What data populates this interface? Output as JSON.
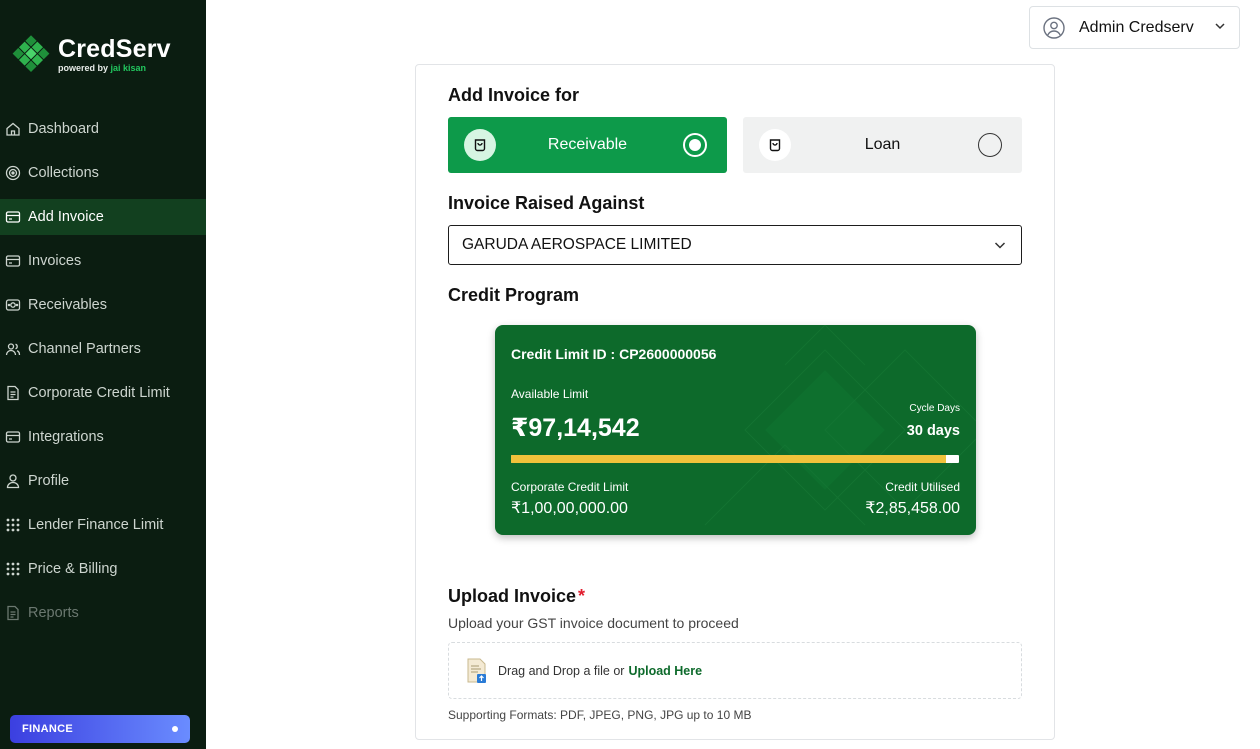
{
  "brand": {
    "name": "CredServ",
    "powered_by": "powered by",
    "powered_name": "jai kisan"
  },
  "sidebar": {
    "items": [
      {
        "label": "Dashboard",
        "icon": "home-icon"
      },
      {
        "label": "Collections",
        "icon": "target-icon"
      },
      {
        "label": "Add Invoice",
        "icon": "invoice-icon",
        "active": true
      },
      {
        "label": "Invoices",
        "icon": "invoice-icon"
      },
      {
        "label": "Receivables",
        "icon": "receivables-icon"
      },
      {
        "label": "Channel Partners",
        "icon": "users-icon"
      },
      {
        "label": "Corporate Credit Limit",
        "icon": "document-icon"
      },
      {
        "label": "Integrations",
        "icon": "integrations-icon"
      },
      {
        "label": "Profile",
        "icon": "user-icon"
      },
      {
        "label": "Lender Finance Limit",
        "icon": "dots-grid-icon"
      },
      {
        "label": "Price & Billing",
        "icon": "dots-grid-icon"
      },
      {
        "label": "Reports",
        "icon": "document-icon",
        "disabled": true
      }
    ],
    "badge": "FINANCE"
  },
  "header": {
    "user_name": "Admin Credserv"
  },
  "form": {
    "add_invoice_for": "Add Invoice for",
    "options": {
      "receivable": "Receivable",
      "loan": "Loan",
      "selected": "Receivable"
    },
    "raised_against_label": "Invoice Raised Against",
    "raised_against_value": "GARUDA AEROSPACE LIMITED",
    "credit_program_label": "Credit Program"
  },
  "credit_card": {
    "id_text": "Credit Limit ID : CP2600000056",
    "available_label": "Available Limit",
    "available_value": "₹97,14,542",
    "cycle_label": "Cycle Days",
    "cycle_value": "30 days",
    "utilisation_fraction": 0.971,
    "corporate_label": "Corporate Credit Limit",
    "corporate_value": "₹1,00,00,000.00",
    "utilised_label": "Credit Utilised",
    "utilised_value": "₹2,85,458.00"
  },
  "upload": {
    "title": "Upload Invoice",
    "required_mark": "*",
    "subtitle": "Upload your GST invoice document to proceed",
    "drop_text": "Drag and Drop a file or",
    "drop_link": "Upload Here",
    "formats": "Supporting Formats: PDF, JPEG, PNG, JPG up to 10 MB"
  },
  "colors": {
    "sidebar_bg": "#0b1d11",
    "primary_green": "#0d9a4a",
    "card_green": "#0d6a2b",
    "progress_yellow": "#f0c23b",
    "finance_badge": "#4f5ff0"
  }
}
